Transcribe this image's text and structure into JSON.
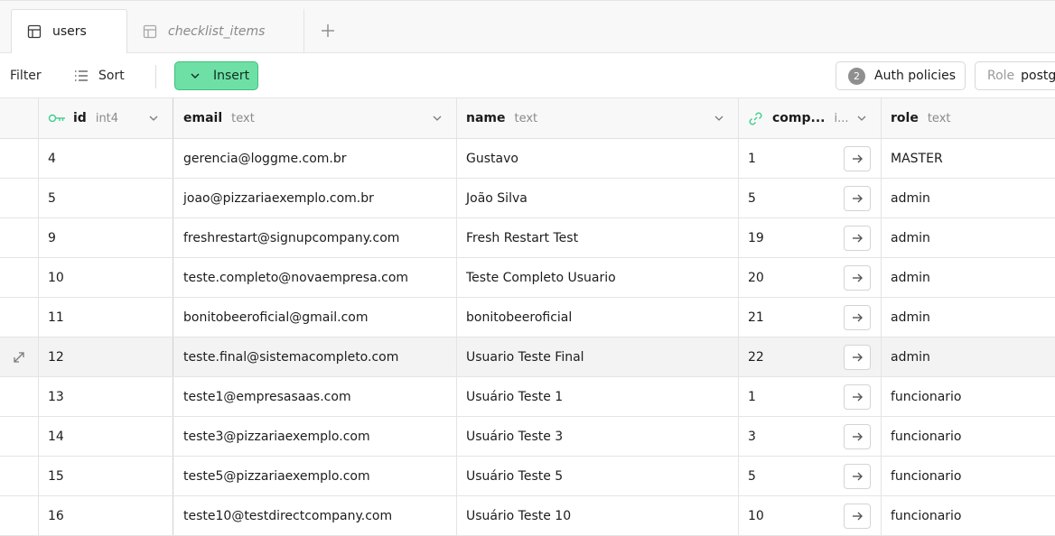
{
  "tabs": [
    {
      "label": "users",
      "active": true,
      "icon": "table-icon"
    },
    {
      "label": "checklist_items",
      "active": false,
      "icon": "table-icon"
    }
  ],
  "toolbar": {
    "filter_label": "Filter",
    "sort_label": "Sort",
    "insert_label": "Insert",
    "auth_policies_count": "2",
    "auth_policies_label": "Auth policies",
    "role_key": "Role",
    "role_value": "postgres"
  },
  "columns": [
    {
      "name": "id",
      "type": "int4",
      "icon": "key-icon"
    },
    {
      "name": "email",
      "type": "text"
    },
    {
      "name": "name",
      "type": "text"
    },
    {
      "name": "comp...",
      "type": "i...",
      "icon": "link-icon"
    },
    {
      "name": "role",
      "type": "text"
    }
  ],
  "rows": [
    {
      "id": "4",
      "email": "gerencia@loggme.com.br",
      "name": "Gustavo",
      "company": "1",
      "role": "MASTER"
    },
    {
      "id": "5",
      "email": "joao@pizzariaexemplo.com.br",
      "name": "João Silva",
      "company": "5",
      "role": "admin"
    },
    {
      "id": "9",
      "email": "freshrestart@signupcompany.com",
      "name": "Fresh Restart Test",
      "company": "19",
      "role": "admin"
    },
    {
      "id": "10",
      "email": "teste.completo@novaempresa.com",
      "name": "Teste Completo Usuario",
      "company": "20",
      "role": "admin"
    },
    {
      "id": "11",
      "email": "bonitobeeroficial@gmail.com",
      "name": "bonitobeeroficial",
      "company": "21",
      "role": "admin"
    },
    {
      "id": "12",
      "email": "teste.final@sistemacompleto.com",
      "name": "Usuario Teste Final",
      "company": "22",
      "role": "admin"
    },
    {
      "id": "13",
      "email": "teste1@empresasaas.com",
      "name": "Usuário Teste 1",
      "company": "1",
      "role": "funcionario"
    },
    {
      "id": "14",
      "email": "teste3@pizzariaexemplo.com",
      "name": "Usuário Teste 3",
      "company": "3",
      "role": "funcionario"
    },
    {
      "id": "15",
      "email": "teste5@pizzariaexemplo.com",
      "name": "Usuário Teste 5",
      "company": "5",
      "role": "funcionario"
    },
    {
      "id": "16",
      "email": "teste10@testdirectcompany.com",
      "name": "Usuário Teste 10",
      "company": "10",
      "role": "funcionario"
    }
  ],
  "colors": {
    "insert_bg": "#6ee0a6",
    "key_icon": "#3ecf8e",
    "link_icon": "#3ecf8e"
  }
}
